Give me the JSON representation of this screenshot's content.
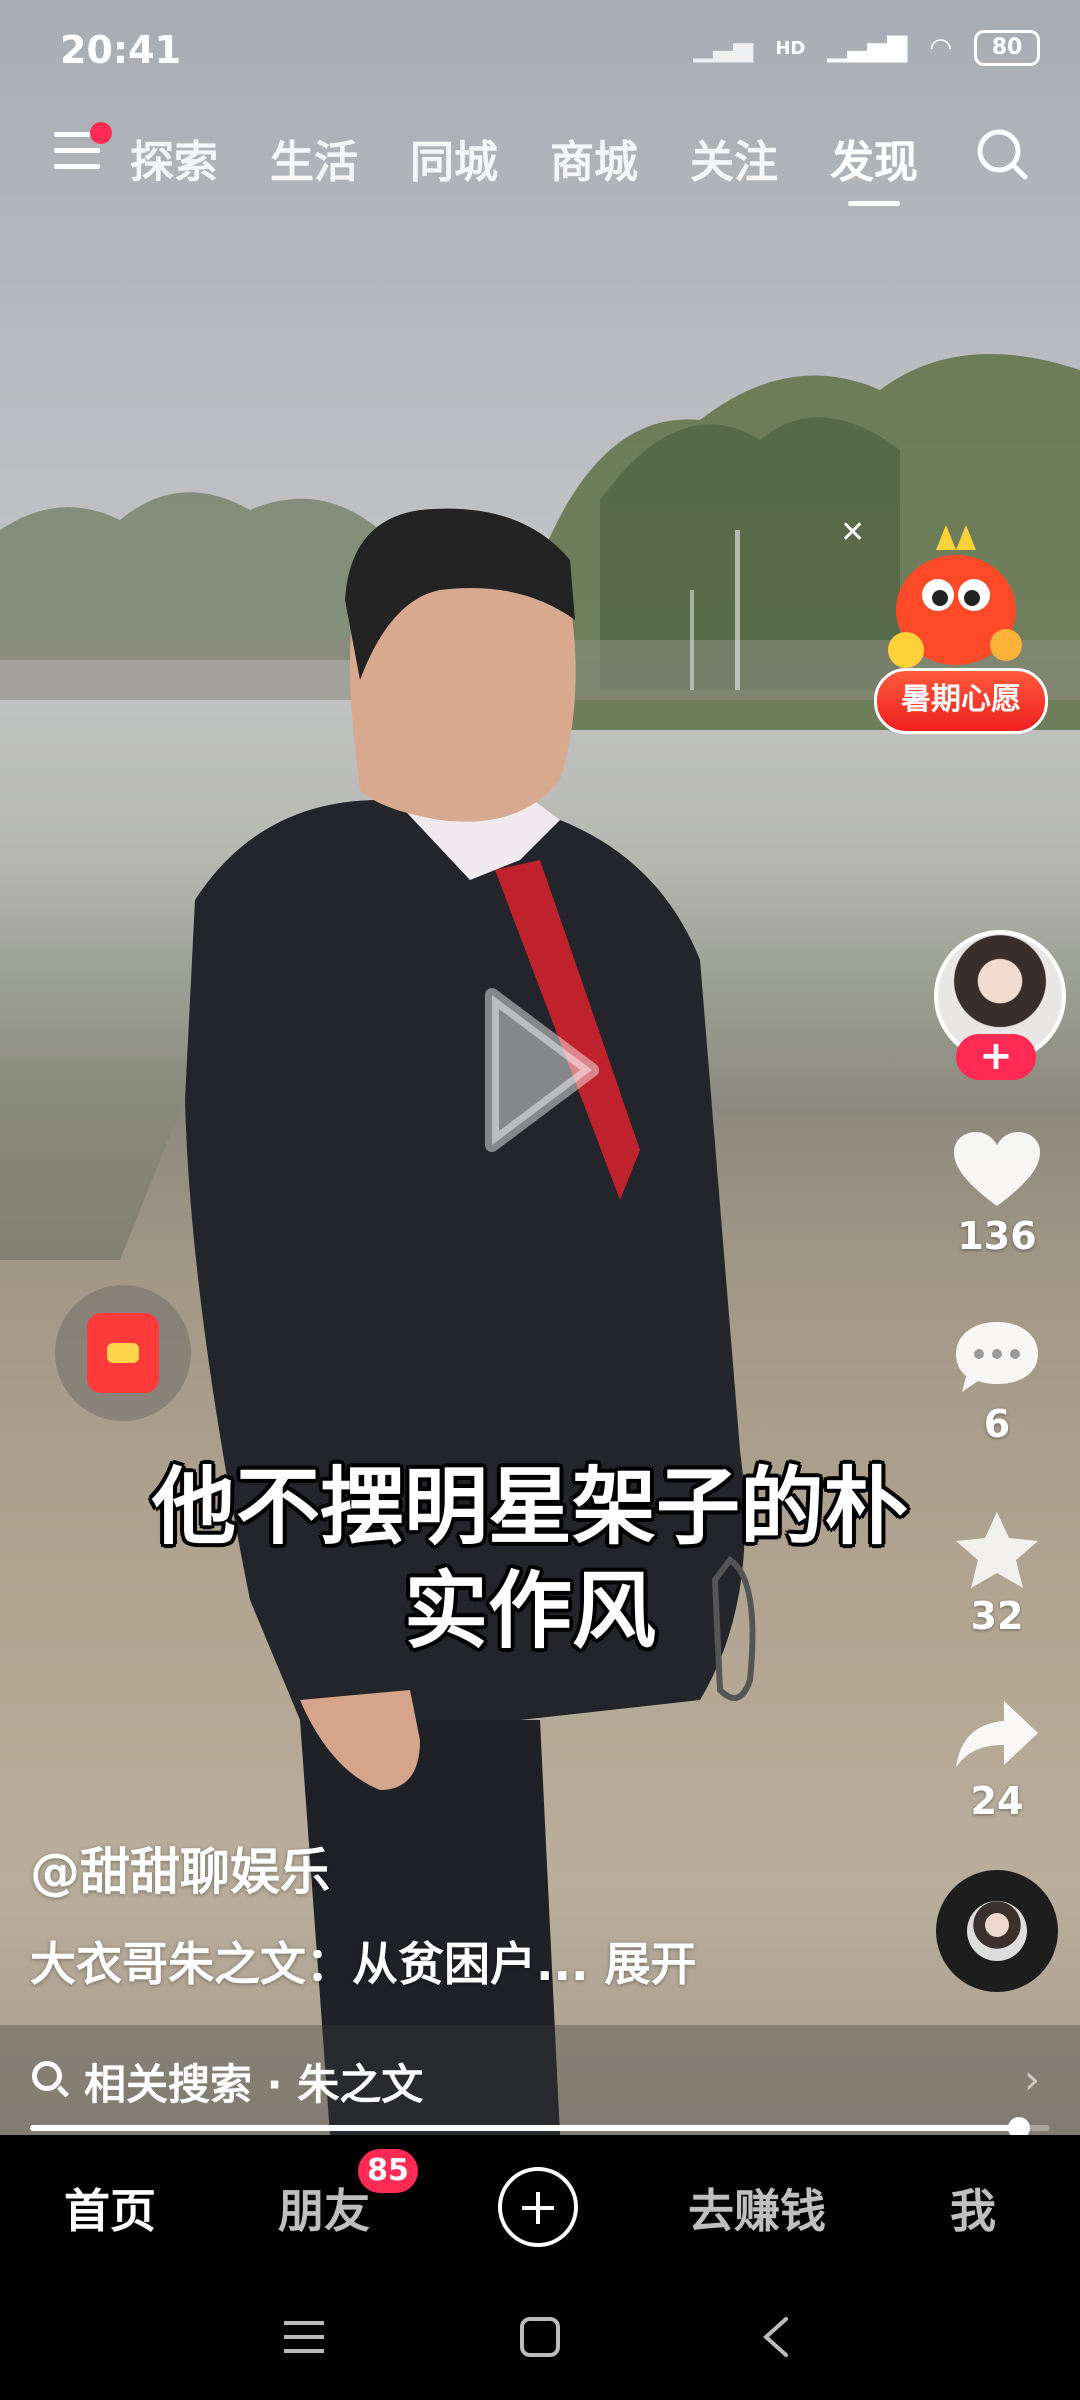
{
  "status_bar": {
    "time": "20:41",
    "network_label": "HD",
    "battery": "80"
  },
  "top_nav": {
    "tabs": [
      "探索",
      "生活",
      "同城",
      "商城",
      "关注",
      "发现"
    ],
    "active_tab": "发现",
    "icons": [
      "menu-icon",
      "search-icon"
    ]
  },
  "promo": {
    "label": "暑期心愿"
  },
  "video": {
    "subtitle_line1": "他不摆明星架子的朴",
    "subtitle_line2": "实作风",
    "author": "@甜甜聊娱乐",
    "description": "大衣哥朱之文：从贫困户... 展开",
    "progress": 0.97
  },
  "actions": {
    "likes": "136",
    "comments": "6",
    "favorites": "32",
    "shares": "24"
  },
  "related_search": {
    "text": "相关搜索 · 朱之文"
  },
  "bottom_nav": {
    "home": "首页",
    "friends": "朋友",
    "friends_badge": "85",
    "earn": "去赚钱",
    "me": "我"
  },
  "colors": {
    "accent": "#ff2b55",
    "promo_red": "#ee2020"
  }
}
